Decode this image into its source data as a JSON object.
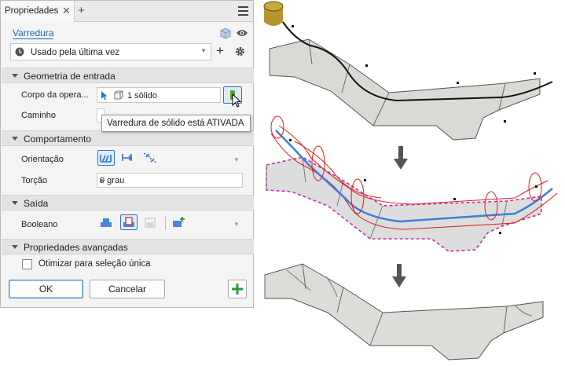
{
  "tab": {
    "title": "Propriedades",
    "close": "✕",
    "add": "+"
  },
  "command": {
    "title": "Varredura"
  },
  "preset": {
    "value": "Usado pela última vez",
    "add": "+"
  },
  "sections": {
    "input_geometry": "Geometria de entrada",
    "behavior": "Comportamento",
    "output": "Saída",
    "advanced": "Propriedades avançadas"
  },
  "fields": {
    "profile_label": "Corpo da opera...",
    "profile_value": "1 sólido",
    "path_label": "Caminho",
    "orientation_label": "Orientação",
    "twist_label": "Torção",
    "twist_value": "0 grau",
    "boolean_label": "Booleano"
  },
  "tooltip": "Varredura de sólido está ATIVADA",
  "advanced": {
    "optimize_label": "Otimizar para seleção única",
    "optimize_checked": false
  },
  "buttons": {
    "ok": "OK",
    "cancel": "Cancelar",
    "apply": "+"
  },
  "colors": {
    "accent": "#1a62c8",
    "solid_toggle": "#4aa52e",
    "preview_red": "#e01b1b",
    "preview_magenta": "#c02fa8",
    "path_blue": "#3d7fd6"
  },
  "icons": [
    "cube-icon",
    "eye-icon",
    "clock-icon",
    "gear-icon",
    "select-arrow-icon",
    "solid-body-icon",
    "solid-toggle-icon",
    "orientation-path-icon",
    "orientation-fixed-icon",
    "orientation-guide-icon",
    "join-icon",
    "cut-icon",
    "intersect-icon",
    "new-solid-icon",
    "down-arrow-icon"
  ]
}
